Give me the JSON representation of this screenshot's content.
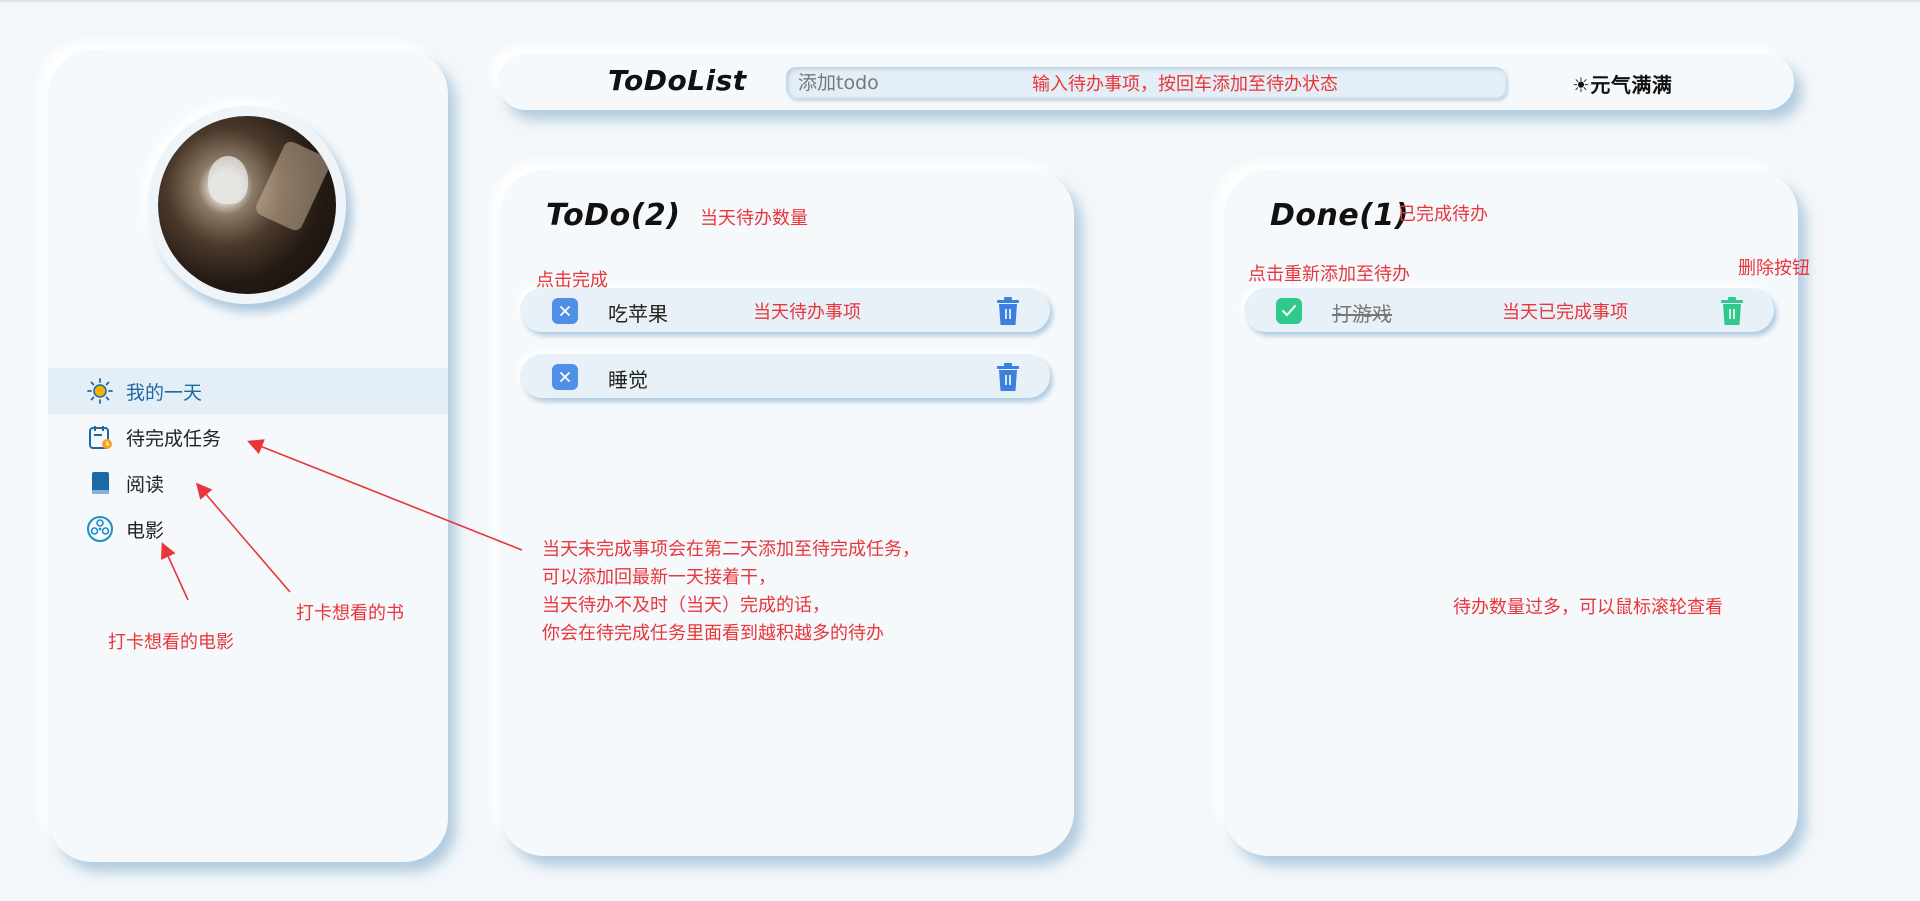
{
  "colors": {
    "accent_blue": "#4f8fe8",
    "done_green": "#2fc98c",
    "annotation_red": "#e8363b"
  },
  "sidebar": {
    "items": [
      {
        "label": "我的一天",
        "icon": "sun-icon",
        "active": true
      },
      {
        "label": "待完成任务",
        "icon": "calendar-clock-icon"
      },
      {
        "label": "阅读",
        "icon": "book-icon"
      },
      {
        "label": "电影",
        "icon": "film-reel-icon"
      }
    ]
  },
  "header": {
    "logo": "ToDoList",
    "search_placeholder": "添加todo",
    "mood": "☀元气满满"
  },
  "todo": {
    "title": "ToDo(2)",
    "items": [
      {
        "text": "吃苹果"
      },
      {
        "text": "睡觉"
      }
    ]
  },
  "done": {
    "title": "Done(1)",
    "items": [
      {
        "text": "打游戏"
      }
    ]
  },
  "annotations": {
    "search_hint": "输入待办事项，按回车添加至待办状态",
    "todo_count": "当天待办数量",
    "click_complete": "点击完成",
    "todo_item": "当天待办事项",
    "done_label": "已完成待办",
    "click_readd": "点击重新添加至待办",
    "delete_btn": "删除按钮",
    "done_item": "当天已完成事项",
    "overflow_1": "当天未完成事项会在第二天添加至待完成任务，",
    "overflow_2": "可以添加回最新一天接着干，",
    "overflow_3": "当天待办不及时（当天）完成的话，",
    "overflow_4": "你会在待完成任务里面看到越积越多的待办",
    "scroll_hint": "待办数量过多，可以鼠标滚轮查看",
    "book_hint": "打卡想看的书",
    "movie_hint": "打卡想看的电影"
  }
}
